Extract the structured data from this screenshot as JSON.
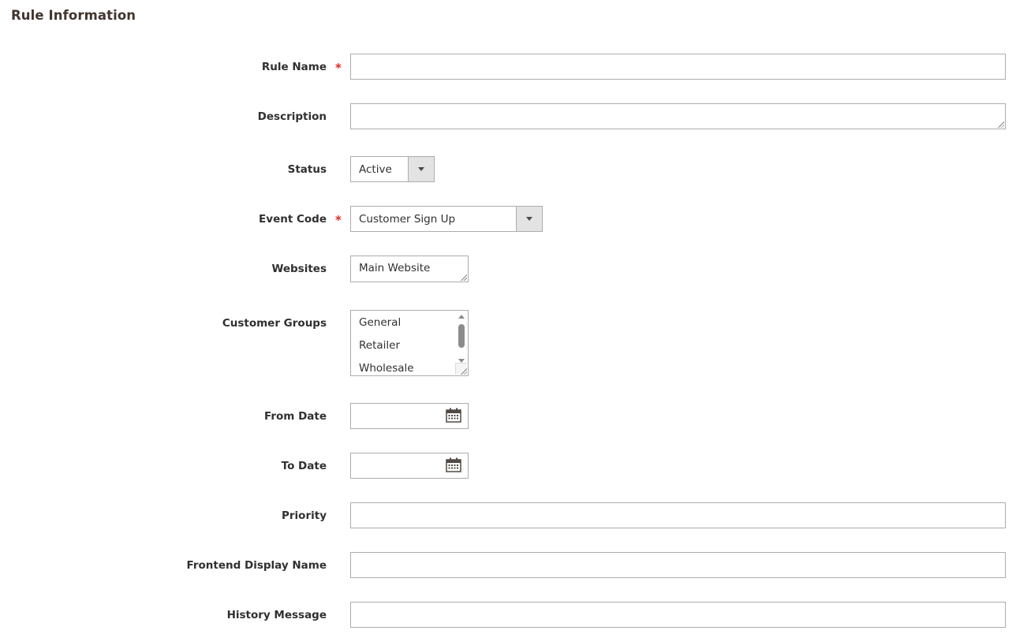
{
  "section": {
    "title": "Rule Information"
  },
  "fields": {
    "rule_name": {
      "label": "Rule Name",
      "required_mark": "*",
      "value": ""
    },
    "description": {
      "label": "Description",
      "value": ""
    },
    "status": {
      "label": "Status",
      "selected": "Active"
    },
    "event_code": {
      "label": "Event Code",
      "required_mark": "*",
      "selected": "Customer Sign Up"
    },
    "websites": {
      "label": "Websites",
      "options": [
        "Main Website"
      ]
    },
    "customer_groups": {
      "label": "Customer Groups",
      "options": [
        "General",
        "Retailer",
        "Wholesale"
      ]
    },
    "from_date": {
      "label": "From Date",
      "value": "",
      "icon": "calendar-icon"
    },
    "to_date": {
      "label": "To Date",
      "value": "",
      "icon": "calendar-icon"
    },
    "priority": {
      "label": "Priority",
      "value": ""
    },
    "frontend_display_name": {
      "label": "Frontend Display Name",
      "value": ""
    },
    "history_message": {
      "label": "History Message",
      "value": ""
    }
  },
  "colors": {
    "required": "#e22626",
    "border": "#adadad",
    "select_button": "#e3e3e3",
    "text": "#303030"
  }
}
